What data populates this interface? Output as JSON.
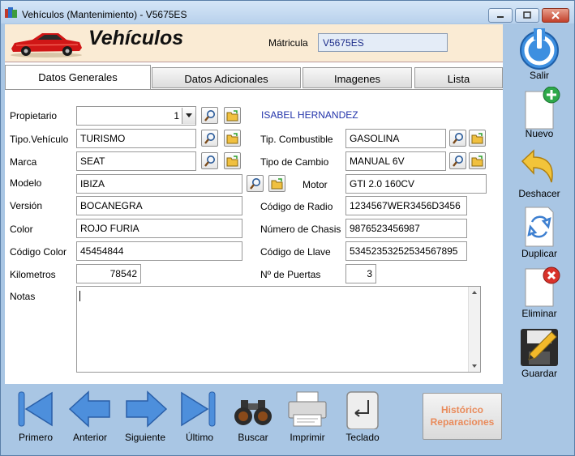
{
  "window": {
    "title": "Vehículos (Mantenimiento) - V5675ES"
  },
  "header": {
    "title": "Vehículos",
    "matricula_label": "Mátricula",
    "matricula_value": "V5675ES"
  },
  "tabs": [
    "Datos Generales",
    "Datos Adicionales",
    "Imagenes",
    "Lista"
  ],
  "form": {
    "propietario": {
      "label": "Propietario",
      "value": "1",
      "name": "ISABEL HERNANDEZ"
    },
    "tipo_vehiculo": {
      "label": "Tipo.Vehículo",
      "value": "TURISMO"
    },
    "marca": {
      "label": "Marca",
      "value": "SEAT"
    },
    "modelo": {
      "label": "Modelo",
      "value": "IBIZA"
    },
    "version": {
      "label": "Versión",
      "value": "BOCANEGRA"
    },
    "color": {
      "label": "Color",
      "value": "ROJO FURIA"
    },
    "codigo_color": {
      "label": "Código Color",
      "value": "45454844"
    },
    "kilometros": {
      "label": "Kilometros",
      "value": "78542"
    },
    "tip_combustible": {
      "label": "Tip. Combustible",
      "value": "GASOLINA"
    },
    "tipo_cambio": {
      "label": "Tipo de Cambio",
      "value": "MANUAL 6V"
    },
    "motor": {
      "label": "Motor",
      "value": "GTI 2.0 160CV"
    },
    "codigo_radio": {
      "label": "Código de Radio",
      "value": "1234567WER3456D3456"
    },
    "numero_chasis": {
      "label": "Número de Chasis",
      "value": "9876523456987"
    },
    "codigo_llave": {
      "label": "Código de Llave",
      "value": "53452353252534567895"
    },
    "puertas": {
      "label": "Nº de Puertas",
      "value": "3"
    },
    "notas": {
      "label": "Notas",
      "value": ""
    }
  },
  "sidebar": {
    "salir": "Salir",
    "nuevo": "Nuevo",
    "deshacer": "Deshacer",
    "duplicar": "Duplicar",
    "eliminar": "Eliminar",
    "guardar": "Guardar"
  },
  "toolbar": {
    "primero": "Primero",
    "anterior": "Anterior",
    "siguiente": "Siguiente",
    "ultimo": "Último",
    "buscar": "Buscar",
    "imprimir": "Imprimir",
    "teclado": "Teclado",
    "historico_line1": "Histórico",
    "historico_line2": "Reparaciones"
  },
  "colors": {
    "window_bg": "#a9c6e4",
    "header_bg": "#faebd4",
    "owner_name": "#2233aa",
    "historico_text": "#e98a5a"
  }
}
